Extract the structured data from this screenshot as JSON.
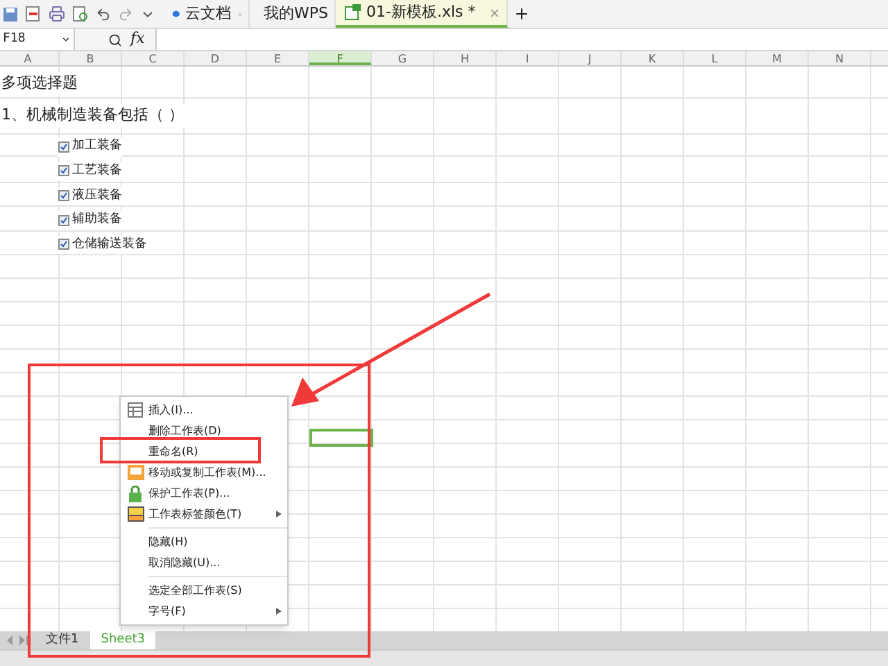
{
  "doc_tabs": [
    {
      "label": "云文档",
      "selected": false
    },
    {
      "label": "我的WPS",
      "selected": false
    },
    {
      "label": "01-新模板.xls *",
      "selected": true
    }
  ],
  "name_box": "F18",
  "formula_label": "fx",
  "columns": [
    {
      "label": "A",
      "selected": false
    },
    {
      "label": "B",
      "selected": false
    },
    {
      "label": "C",
      "selected": false
    },
    {
      "label": "D",
      "selected": false
    },
    {
      "label": "E",
      "selected": false
    },
    {
      "label": "F",
      "selected": true
    },
    {
      "label": "G",
      "selected": false
    },
    {
      "label": "H",
      "selected": false
    },
    {
      "label": "I",
      "selected": false
    },
    {
      "label": "J",
      "selected": false
    },
    {
      "label": "K",
      "selected": false
    },
    {
      "label": "L",
      "selected": false
    },
    {
      "label": "M",
      "selected": false
    },
    {
      "label": "N",
      "selected": false
    }
  ],
  "sheet_rows": [
    {
      "kind": "text",
      "text": "多项选择题"
    },
    {
      "kind": "text",
      "text": "1、机械制造装备包括（    ）"
    },
    {
      "kind": "checkbox",
      "text": "加工装备",
      "checked": true
    },
    {
      "kind": "checkbox",
      "text": "工艺装备",
      "checked": true
    },
    {
      "kind": "checkbox",
      "text": "液压装备",
      "checked": true
    },
    {
      "kind": "checkbox",
      "text": "辅助装备",
      "checked": true
    },
    {
      "kind": "checkbox",
      "text": "仓储输送装备",
      "checked": true
    }
  ],
  "context_menu": [
    {
      "kind": "item",
      "label": "插入(I)...",
      "submenu": false
    },
    {
      "kind": "item",
      "label": "删除工作表(D)",
      "submenu": false
    },
    {
      "kind": "item",
      "label": "重命名(R)",
      "submenu": false
    },
    {
      "kind": "item",
      "label": "移动或复制工作表(M)...",
      "submenu": false
    },
    {
      "kind": "item",
      "label": "保护工作表(P)...",
      "submenu": false
    },
    {
      "kind": "item",
      "label": "工作表标签颜色(T)",
      "submenu": true
    },
    {
      "kind": "separator"
    },
    {
      "kind": "item",
      "label": "隐藏(H)",
      "submenu": false
    },
    {
      "kind": "item",
      "label": "取消隐藏(U)...",
      "submenu": false
    },
    {
      "kind": "separator"
    },
    {
      "kind": "item",
      "label": "选定全部工作表(S)",
      "submenu": false
    },
    {
      "kind": "item",
      "label": "字号(F)",
      "submenu": true
    }
  ],
  "sheet_tabs": [
    {
      "label": "文件1",
      "selected": false
    },
    {
      "label": "Sheet3",
      "selected": true
    }
  ]
}
